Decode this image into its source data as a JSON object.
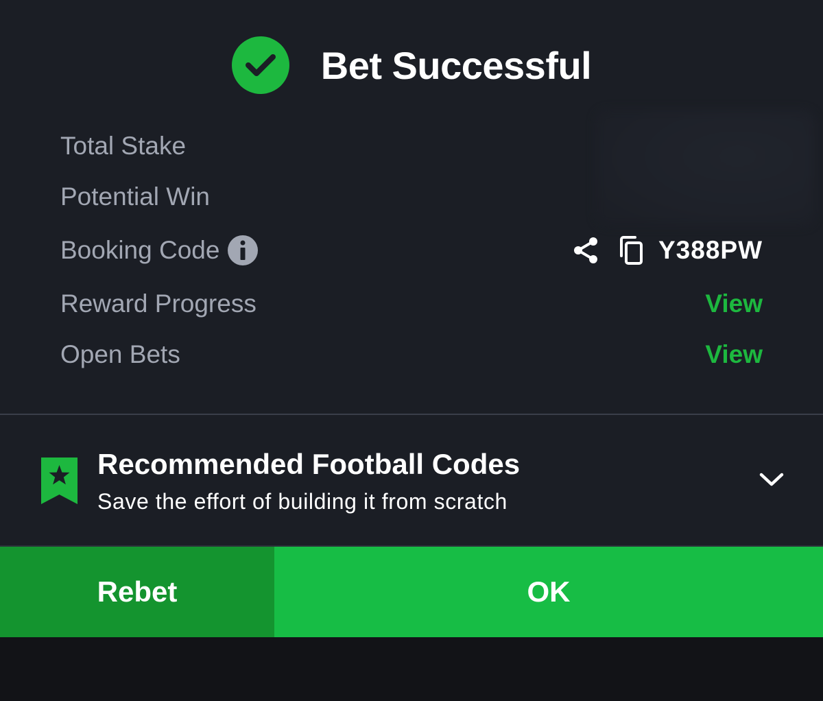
{
  "header": {
    "title": "Bet Successful",
    "icon": "check-circle-icon"
  },
  "details": {
    "total_stake_label": "Total Stake",
    "potential_win_label": "Potential Win",
    "booking_code_label": "Booking Code",
    "booking_code_value": "Y388PW",
    "reward_progress_label": "Reward Progress",
    "reward_progress_link": "View",
    "open_bets_label": "Open Bets",
    "open_bets_link": "View"
  },
  "recommended": {
    "title": "Recommended Football Codes",
    "subtitle": "Save the effort of building it from scratch"
  },
  "actions": {
    "rebet_label": "Rebet",
    "ok_label": "OK"
  },
  "colors": {
    "background": "#1b1e25",
    "accent_green": "#1db83f",
    "rebet_button": "#14942f",
    "ok_button": "#17bd45",
    "label_gray": "#a2a7b3"
  }
}
